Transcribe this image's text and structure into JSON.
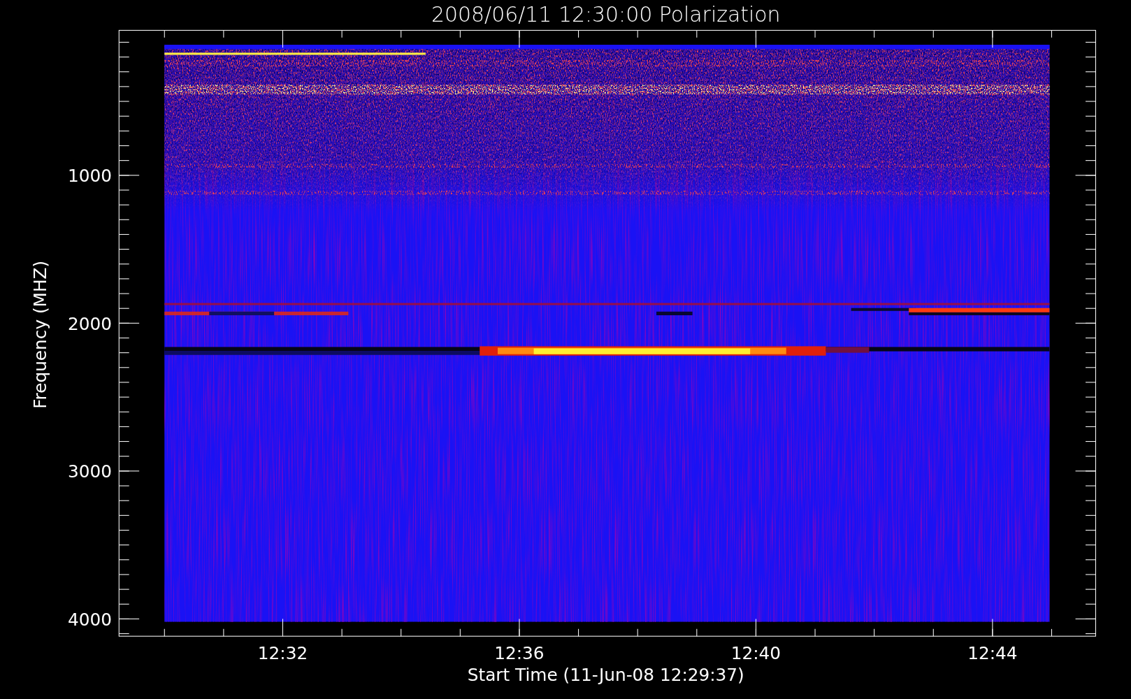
{
  "title": "2008/06/11 12:30:00 Polarization",
  "xlabel": "Start Time (11-Jun-08 12:29:37)",
  "ylabel": "Frequency (MHZ)",
  "xticks": [
    {
      "label": "12:32"
    },
    {
      "label": "12:36"
    },
    {
      "label": "12:40"
    },
    {
      "label": "12:44"
    }
  ],
  "yticks": [
    {
      "label": "1000"
    },
    {
      "label": "2000"
    },
    {
      "label": "3000"
    },
    {
      "label": "4000"
    }
  ]
}
